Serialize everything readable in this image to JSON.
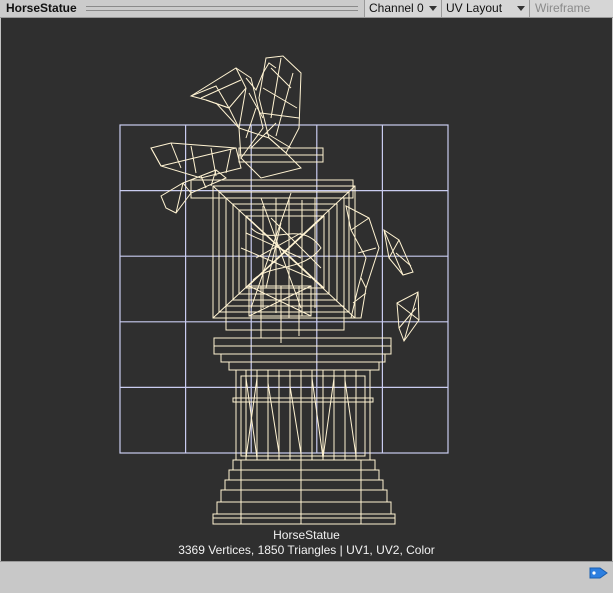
{
  "header": {
    "title": "HorseStatue",
    "channel": "Channel 0",
    "view_mode": "UV Layout",
    "wireframe_label": "Wireframe"
  },
  "viewport": {
    "mesh_name": "HorseStatue",
    "mesh_stats": "3369 Vertices, 1850 Triangles | UV1, UV2, Color",
    "background": "#2f2f2f",
    "wire_color": "#fff3d2",
    "grid_color": "#c9ccf0"
  },
  "footer": {
    "icon": "tag-icon"
  }
}
